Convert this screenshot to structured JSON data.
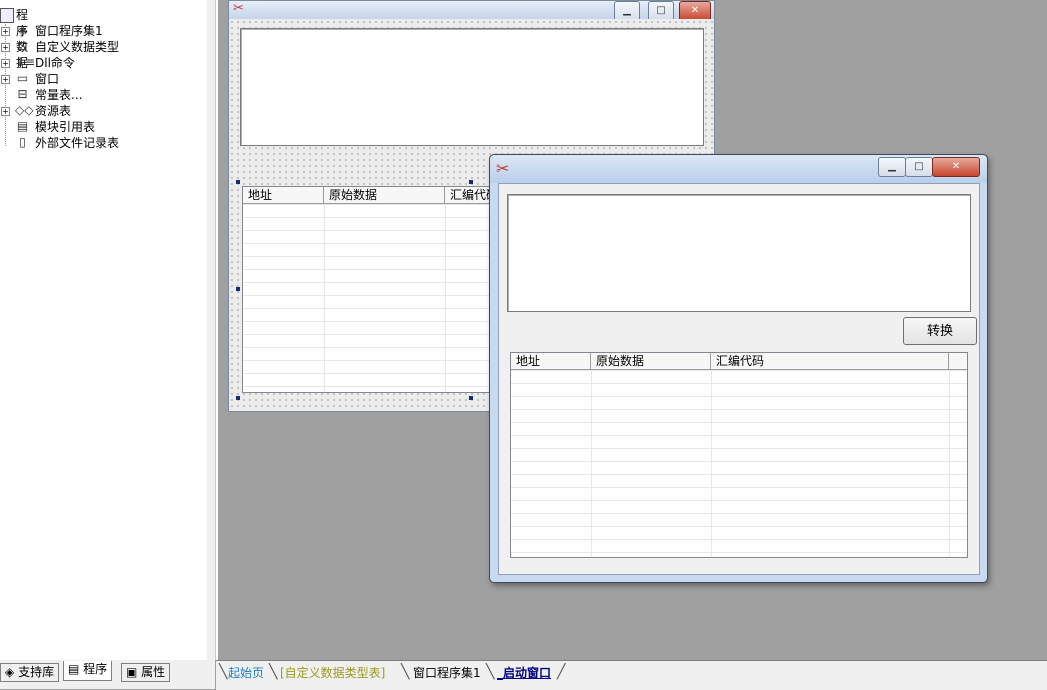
{
  "tree": {
    "root": "程序数据",
    "items": [
      {
        "label": "窗口程序集1",
        "expandable": true,
        "icon": "layers-icon"
      },
      {
        "label": "自定义数据类型",
        "expandable": true,
        "icon": "datatype-icon"
      },
      {
        "label": "Dll命令",
        "expandable": true,
        "icon": "dll-icon"
      },
      {
        "label": "窗口",
        "expandable": true,
        "icon": "window-icon"
      },
      {
        "label": "常量表...",
        "expandable": false,
        "icon": "constant-icon"
      },
      {
        "label": "资源表",
        "expandable": true,
        "icon": "resource-icon"
      },
      {
        "label": "模块引用表",
        "expandable": false,
        "icon": "module-icon"
      },
      {
        "label": "外部文件记录表",
        "expandable": false,
        "icon": "file-icon"
      }
    ]
  },
  "left_tabs": [
    {
      "label": "支持库",
      "icon": "library-icon"
    },
    {
      "label": "程序",
      "icon": "program-icon",
      "active": true
    },
    {
      "label": "属性",
      "icon": "properties-icon"
    }
  ],
  "editor_tabs": [
    {
      "label": "起始页",
      "color": "#1e7fbf"
    },
    {
      "label": "[自定义数据类型表]",
      "color": "#9a9a20"
    },
    {
      "label": "窗口程序集1",
      "color": "#000000"
    },
    {
      "label": "_启动窗口",
      "color": "#000080",
      "active": true
    }
  ],
  "design_form": {
    "list_columns": [
      "地址",
      "原始数据",
      "汇编代码"
    ]
  },
  "run_window": {
    "title": "",
    "convert_button": "转换",
    "list_columns": [
      "地址",
      "原始数据",
      "汇编代码"
    ]
  },
  "caption_buttons": {
    "minimize": "▁",
    "maximize": "□",
    "close": "✕"
  }
}
